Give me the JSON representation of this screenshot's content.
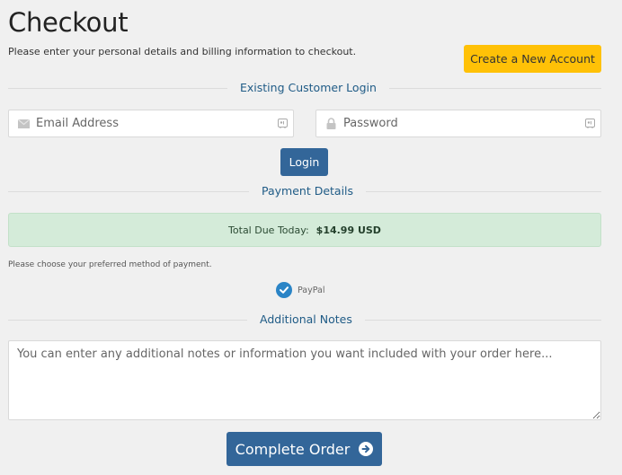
{
  "header": {
    "title": "Checkout",
    "subtitle": "Please enter your personal details and billing information to checkout.",
    "create_account_label": "Create a New Account"
  },
  "login": {
    "section_title": "Existing Customer Login",
    "email_placeholder": "Email Address",
    "email_value": "",
    "password_placeholder": "Password",
    "password_value": "",
    "login_label": "Login"
  },
  "payment": {
    "section_title": "Payment Details",
    "total_label": "Total Due Today:",
    "total_amount": "$14.99 USD",
    "hint": "Please choose your preferred method of payment.",
    "methods": [
      {
        "label": "PayPal",
        "selected": true,
        "icon": "check-circle-icon"
      }
    ]
  },
  "notes": {
    "section_title": "Additional Notes",
    "placeholder": "You can enter any additional notes or information you want included with your order here...",
    "value": ""
  },
  "actions": {
    "complete_label": "Complete Order",
    "complete_icon": "arrow-circle-right-icon"
  },
  "icons": {
    "email": "envelope-icon",
    "password": "lock-icon",
    "autofill": "autofill-badge-icon"
  },
  "colors": {
    "primary": "#336699",
    "warning": "#ffc107",
    "success_bg": "#d4ebd9",
    "section_title": "#1f5b86",
    "check": "#2a84c6",
    "background": "#f0f0f0"
  }
}
